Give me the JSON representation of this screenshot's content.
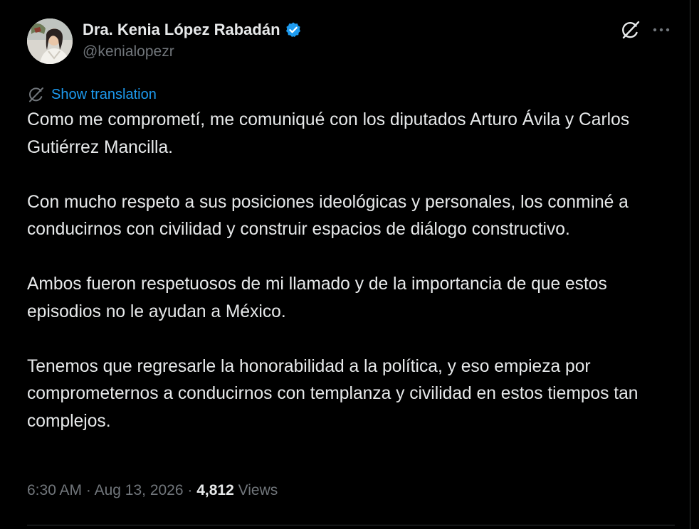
{
  "author": {
    "display_name": "Dra. Kenia López Rabadán",
    "handle": "@kenialopezr",
    "verified": true,
    "verified_color": "#1d9bf0"
  },
  "actions": {
    "grok_icon": "grok-icon",
    "more_icon": "more-icon"
  },
  "translation": {
    "label": "Show translation",
    "icon": "translate-icon",
    "color": "#1d9bf0"
  },
  "tweet": {
    "paragraphs": [
      "Como me comprometí, me comuniqué con los diputados Arturo Ávila y Carlos Gutiérrez Mancilla.",
      "Con mucho respeto a sus posiciones ideológicas y personales, los conminé a conducirnos con civilidad y construir espacios de diálogo constructivo.",
      "Ambos fueron respetuosos de mi llamado y de la importancia de que estos episodios no le ayudan a México.",
      "Tenemos que regresarle la honorabilidad a la política, y eso empieza por comprometernos a conducirnos con templanza y civilidad en estos tiempos tan complejos."
    ]
  },
  "meta": {
    "time": "6:30 AM",
    "separator": "·",
    "date": "Aug 13, 2026",
    "views_count": "4,812",
    "views_label": "Views"
  },
  "theme": {
    "background": "#000000",
    "text": "#e7e9ea",
    "secondary_text": "#71767b",
    "accent": "#1d9bf0"
  }
}
